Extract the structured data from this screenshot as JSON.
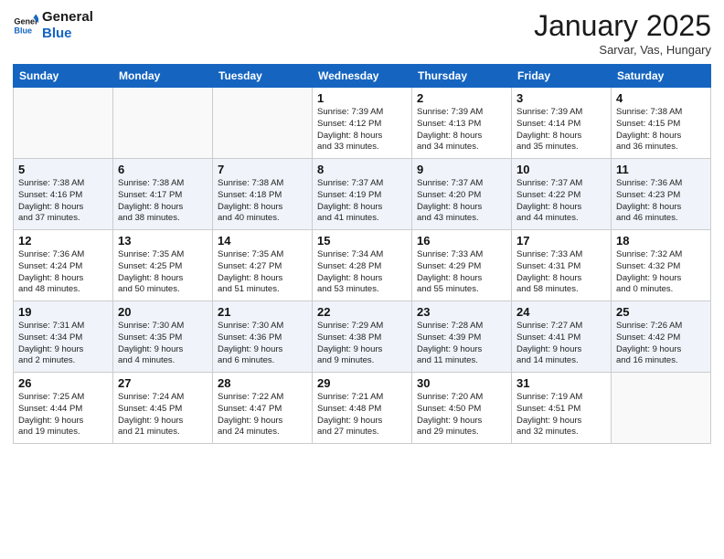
{
  "logo": {
    "line1": "General",
    "line2": "Blue"
  },
  "title": "January 2025",
  "location": "Sarvar, Vas, Hungary",
  "weekdays": [
    "Sunday",
    "Monday",
    "Tuesday",
    "Wednesday",
    "Thursday",
    "Friday",
    "Saturday"
  ],
  "weeks": [
    [
      {
        "day": "",
        "info": ""
      },
      {
        "day": "",
        "info": ""
      },
      {
        "day": "",
        "info": ""
      },
      {
        "day": "1",
        "info": "Sunrise: 7:39 AM\nSunset: 4:12 PM\nDaylight: 8 hours\nand 33 minutes."
      },
      {
        "day": "2",
        "info": "Sunrise: 7:39 AM\nSunset: 4:13 PM\nDaylight: 8 hours\nand 34 minutes."
      },
      {
        "day": "3",
        "info": "Sunrise: 7:39 AM\nSunset: 4:14 PM\nDaylight: 8 hours\nand 35 minutes."
      },
      {
        "day": "4",
        "info": "Sunrise: 7:38 AM\nSunset: 4:15 PM\nDaylight: 8 hours\nand 36 minutes."
      }
    ],
    [
      {
        "day": "5",
        "info": "Sunrise: 7:38 AM\nSunset: 4:16 PM\nDaylight: 8 hours\nand 37 minutes."
      },
      {
        "day": "6",
        "info": "Sunrise: 7:38 AM\nSunset: 4:17 PM\nDaylight: 8 hours\nand 38 minutes."
      },
      {
        "day": "7",
        "info": "Sunrise: 7:38 AM\nSunset: 4:18 PM\nDaylight: 8 hours\nand 40 minutes."
      },
      {
        "day": "8",
        "info": "Sunrise: 7:37 AM\nSunset: 4:19 PM\nDaylight: 8 hours\nand 41 minutes."
      },
      {
        "day": "9",
        "info": "Sunrise: 7:37 AM\nSunset: 4:20 PM\nDaylight: 8 hours\nand 43 minutes."
      },
      {
        "day": "10",
        "info": "Sunrise: 7:37 AM\nSunset: 4:22 PM\nDaylight: 8 hours\nand 44 minutes."
      },
      {
        "day": "11",
        "info": "Sunrise: 7:36 AM\nSunset: 4:23 PM\nDaylight: 8 hours\nand 46 minutes."
      }
    ],
    [
      {
        "day": "12",
        "info": "Sunrise: 7:36 AM\nSunset: 4:24 PM\nDaylight: 8 hours\nand 48 minutes."
      },
      {
        "day": "13",
        "info": "Sunrise: 7:35 AM\nSunset: 4:25 PM\nDaylight: 8 hours\nand 50 minutes."
      },
      {
        "day": "14",
        "info": "Sunrise: 7:35 AM\nSunset: 4:27 PM\nDaylight: 8 hours\nand 51 minutes."
      },
      {
        "day": "15",
        "info": "Sunrise: 7:34 AM\nSunset: 4:28 PM\nDaylight: 8 hours\nand 53 minutes."
      },
      {
        "day": "16",
        "info": "Sunrise: 7:33 AM\nSunset: 4:29 PM\nDaylight: 8 hours\nand 55 minutes."
      },
      {
        "day": "17",
        "info": "Sunrise: 7:33 AM\nSunset: 4:31 PM\nDaylight: 8 hours\nand 58 minutes."
      },
      {
        "day": "18",
        "info": "Sunrise: 7:32 AM\nSunset: 4:32 PM\nDaylight: 9 hours\nand 0 minutes."
      }
    ],
    [
      {
        "day": "19",
        "info": "Sunrise: 7:31 AM\nSunset: 4:34 PM\nDaylight: 9 hours\nand 2 minutes."
      },
      {
        "day": "20",
        "info": "Sunrise: 7:30 AM\nSunset: 4:35 PM\nDaylight: 9 hours\nand 4 minutes."
      },
      {
        "day": "21",
        "info": "Sunrise: 7:30 AM\nSunset: 4:36 PM\nDaylight: 9 hours\nand 6 minutes."
      },
      {
        "day": "22",
        "info": "Sunrise: 7:29 AM\nSunset: 4:38 PM\nDaylight: 9 hours\nand 9 minutes."
      },
      {
        "day": "23",
        "info": "Sunrise: 7:28 AM\nSunset: 4:39 PM\nDaylight: 9 hours\nand 11 minutes."
      },
      {
        "day": "24",
        "info": "Sunrise: 7:27 AM\nSunset: 4:41 PM\nDaylight: 9 hours\nand 14 minutes."
      },
      {
        "day": "25",
        "info": "Sunrise: 7:26 AM\nSunset: 4:42 PM\nDaylight: 9 hours\nand 16 minutes."
      }
    ],
    [
      {
        "day": "26",
        "info": "Sunrise: 7:25 AM\nSunset: 4:44 PM\nDaylight: 9 hours\nand 19 minutes."
      },
      {
        "day": "27",
        "info": "Sunrise: 7:24 AM\nSunset: 4:45 PM\nDaylight: 9 hours\nand 21 minutes."
      },
      {
        "day": "28",
        "info": "Sunrise: 7:22 AM\nSunset: 4:47 PM\nDaylight: 9 hours\nand 24 minutes."
      },
      {
        "day": "29",
        "info": "Sunrise: 7:21 AM\nSunset: 4:48 PM\nDaylight: 9 hours\nand 27 minutes."
      },
      {
        "day": "30",
        "info": "Sunrise: 7:20 AM\nSunset: 4:50 PM\nDaylight: 9 hours\nand 29 minutes."
      },
      {
        "day": "31",
        "info": "Sunrise: 7:19 AM\nSunset: 4:51 PM\nDaylight: 9 hours\nand 32 minutes."
      },
      {
        "day": "",
        "info": ""
      }
    ]
  ]
}
